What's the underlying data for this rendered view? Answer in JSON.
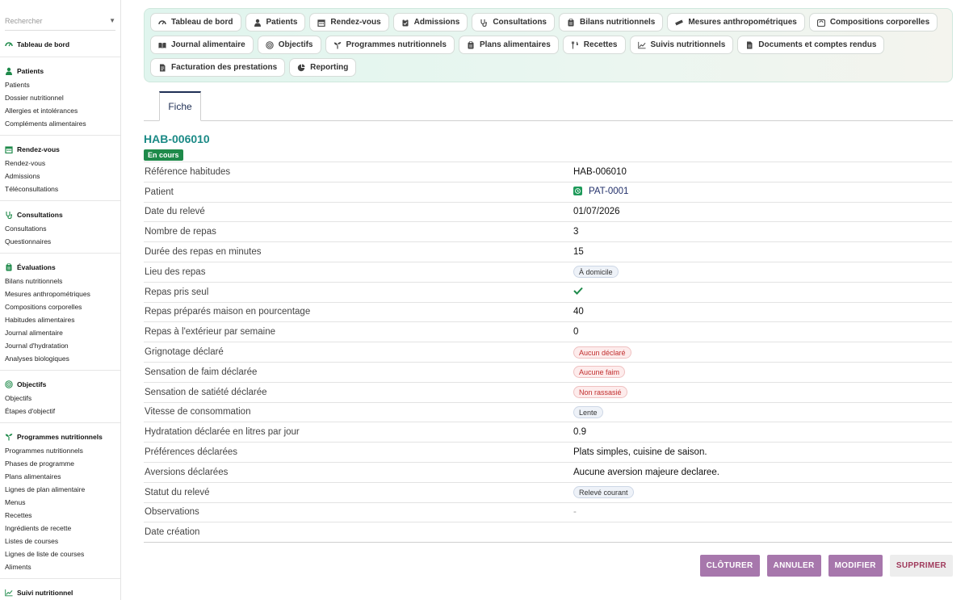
{
  "sidebar": {
    "search_placeholder": "Rechercher",
    "dashboard": "Tableau de bord",
    "groups": [
      {
        "title": "Patients",
        "icon": "person-icon",
        "items": [
          "Patients",
          "Dossier nutritionnel",
          "Allergies et intolérances",
          "Compléments alimentaires"
        ]
      },
      {
        "title": "Rendez-vous",
        "icon": "calendar-icon",
        "items": [
          "Rendez-vous",
          "Admissions",
          "Téléconsultations"
        ]
      },
      {
        "title": "Consultations",
        "icon": "stethoscope-icon",
        "items": [
          "Consultations",
          "Questionnaires"
        ]
      },
      {
        "title": "Évaluations",
        "icon": "clipboard-icon",
        "items": [
          "Bilans nutritionnels",
          "Mesures anthropométriques",
          "Compositions corporelles",
          "Habitudes alimentaires",
          "Journal alimentaire",
          "Journal d'hydratation",
          "Analyses biologiques"
        ]
      },
      {
        "title": "Objectifs",
        "icon": "target-icon",
        "items": [
          "Objectifs",
          "Étapes d'objectif"
        ]
      },
      {
        "title": "Programmes nutritionnels",
        "icon": "seedling-icon",
        "items": [
          "Programmes nutritionnels",
          "Phases de programme",
          "Plans alimentaires",
          "Lignes de plan alimentaire",
          "Menus",
          "Recettes",
          "Ingrédients de recette",
          "Listes de courses",
          "Lignes de liste de courses",
          "Aliments"
        ]
      },
      {
        "title": "Suivi nutritionnel",
        "icon": "chart-line-icon",
        "items": [
          "Suivis nutritionnels"
        ]
      }
    ]
  },
  "nav": {
    "rows": [
      [
        {
          "label": "Tableau de bord",
          "icon": "gauge-icon"
        },
        {
          "label": "Patients",
          "icon": "person-icon"
        },
        {
          "label": "Rendez-vous",
          "icon": "calendar-icon"
        },
        {
          "label": "Admissions",
          "icon": "clipboard-check-icon"
        },
        {
          "label": "Consultations",
          "icon": "stethoscope-icon"
        },
        {
          "label": "Bilans nutritionnels",
          "icon": "clipboard-icon"
        },
        {
          "label": "Mesures anthropométriques",
          "icon": "ruler-icon"
        },
        {
          "label": "Compositions corporelles",
          "icon": "scale-icon"
        }
      ],
      [
        {
          "label": "Journal alimentaire",
          "icon": "book-icon"
        },
        {
          "label": "Objectifs",
          "icon": "target-icon"
        },
        {
          "label": "Programmes nutritionnels",
          "icon": "seedling-icon"
        },
        {
          "label": "Plans alimentaires",
          "icon": "clipboard-icon"
        },
        {
          "label": "Recettes",
          "icon": "utensils-icon"
        },
        {
          "label": "Suivis nutritionnels",
          "icon": "chart-line-icon"
        },
        {
          "label": "Documents et comptes rendus",
          "icon": "file-icon"
        }
      ],
      [
        {
          "label": "Facturation des prestations",
          "icon": "invoice-icon"
        },
        {
          "label": "Reporting",
          "icon": "pie-chart-icon"
        }
      ]
    ]
  },
  "tabs": {
    "fiche": "Fiche"
  },
  "record": {
    "title": "HAB-006010",
    "status_badge": "En cours",
    "fields": [
      {
        "label": "Référence habitudes",
        "type": "text",
        "value": "HAB-006010"
      },
      {
        "label": "Patient",
        "type": "link",
        "value": "PAT-0001"
      },
      {
        "label": "Date du relevé",
        "type": "text",
        "value": "01/07/2026"
      },
      {
        "label": "Nombre de repas",
        "type": "text",
        "value": "3"
      },
      {
        "label": "Durée des repas en minutes",
        "type": "text",
        "value": "15"
      },
      {
        "label": "Lieu des repas",
        "type": "pill-blue",
        "value": "À domicile"
      },
      {
        "label": "Repas pris seul",
        "type": "check",
        "value": ""
      },
      {
        "label": "Repas préparés maison en pourcentage",
        "type": "text",
        "value": "40"
      },
      {
        "label": "Repas à l'extérieur par semaine",
        "type": "text",
        "value": "0"
      },
      {
        "label": "Grignotage déclaré",
        "type": "pill-red",
        "value": "Aucun déclaré"
      },
      {
        "label": "Sensation de faim déclarée",
        "type": "pill-red",
        "value": "Aucune faim"
      },
      {
        "label": "Sensation de satiété déclarée",
        "type": "pill-red",
        "value": "Non rassasié"
      },
      {
        "label": "Vitesse de consommation",
        "type": "pill-blue",
        "value": "Lente"
      },
      {
        "label": "Hydratation déclarée en litres par jour",
        "type": "text",
        "value": "0.9"
      },
      {
        "label": "Préférences déclarées",
        "type": "text",
        "value": "Plats simples, cuisine de saison."
      },
      {
        "label": "Aversions déclarées",
        "type": "text",
        "value": "Aucune aversion majeure declaree."
      },
      {
        "label": "Statut du relevé",
        "type": "pill-blue",
        "value": "Relevé courant"
      },
      {
        "label": "Observations",
        "type": "dash",
        "value": "-"
      },
      {
        "label": "Date création",
        "type": "text",
        "value": ""
      }
    ]
  },
  "actions": {
    "cloturer": "CLÔTURER",
    "annuler": "ANNULER",
    "modifier": "MODIFIER",
    "supprimer": "SUPPRIMER"
  },
  "colors": {
    "accent": "#1b8a86",
    "primary_action": "#a777ac",
    "success": "#1e8a4a"
  }
}
